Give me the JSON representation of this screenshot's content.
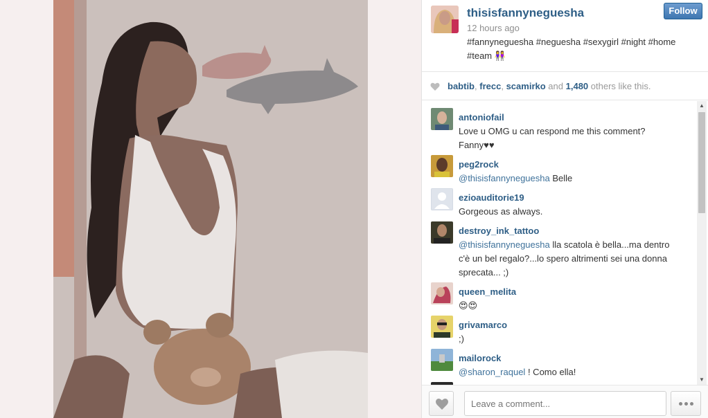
{
  "post": {
    "owner": "thisisfannyneguesha",
    "time": "12 hours ago",
    "caption_line1": "#fannyneguesha #neguesha #sexygirl #night #home",
    "caption_line2": "#team 👭",
    "follow_label": "Follow"
  },
  "likes": {
    "user1": "babtib",
    "sep1": ",",
    "user2": "frecc",
    "sep2": ",",
    "user3": "scamirko",
    "and": "and",
    "count": "1,480",
    "suffix": "others like this."
  },
  "comments": [
    {
      "user": "antoniofail",
      "line1": "Love u OMG u can respond me this comment?",
      "line2": "Fanny♥♥"
    },
    {
      "user": "peg2rock",
      "mention": "@thisisfannyneguesha",
      "text": "Belle"
    },
    {
      "user": "ezioauditorie19",
      "text": "Gorgeous as always."
    },
    {
      "user": "destroy_ink_tattoo",
      "mention": "@thisisfannyneguesha",
      "line1": "lla scatola è bella...ma dentro",
      "line2": "c'è un bel regalo?...lo spero altrimenti sei una donna",
      "line3": "sprecata... ;)"
    },
    {
      "user": "queen_melita",
      "text": "😍😍"
    },
    {
      "user": "grivamarco",
      "text": ";)"
    },
    {
      "user": "mailorock",
      "mention": "@sharon_raquel",
      "text": "! Como ella!"
    }
  ],
  "composer": {
    "placeholder": "Leave a comment..."
  },
  "colors": {
    "link": "#2e5e86",
    "follow_button": "#3f77b1"
  },
  "icons": {
    "like": "heart-icon",
    "more": "ellipsis-icon"
  }
}
